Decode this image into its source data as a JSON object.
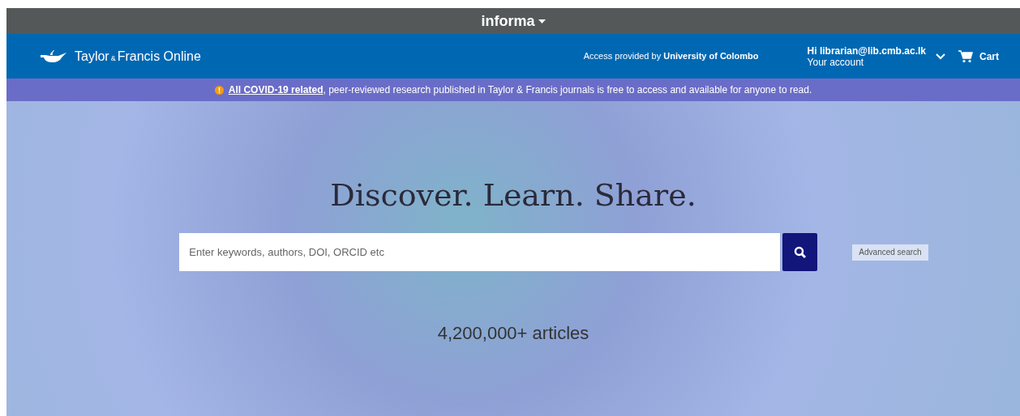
{
  "top_bar": {
    "brand": "informa"
  },
  "header": {
    "logo_text": "Taylor",
    "logo_amp": "&",
    "logo_text_2": "Francis Online",
    "access": "Access provided by **University of Colombo**",
    "account_greeting": "Hi librarian@lib.cmb.ac.lk",
    "account_link": "Your account",
    "cart": "Cart"
  },
  "banner": {
    "link": "All COVID-19 related",
    "text": ", peer-reviewed research published in Taylor & Francis journals is free to access and available for anyone to read."
  },
  "hero": {
    "heading": "Discover. Learn. Share.",
    "search": {
      "placeholder": "Enter keywords, authors, DOI, ORCID etc"
    },
    "advanced_search": "Advanced search",
    "count": "4,200,000+ articles"
  }
}
